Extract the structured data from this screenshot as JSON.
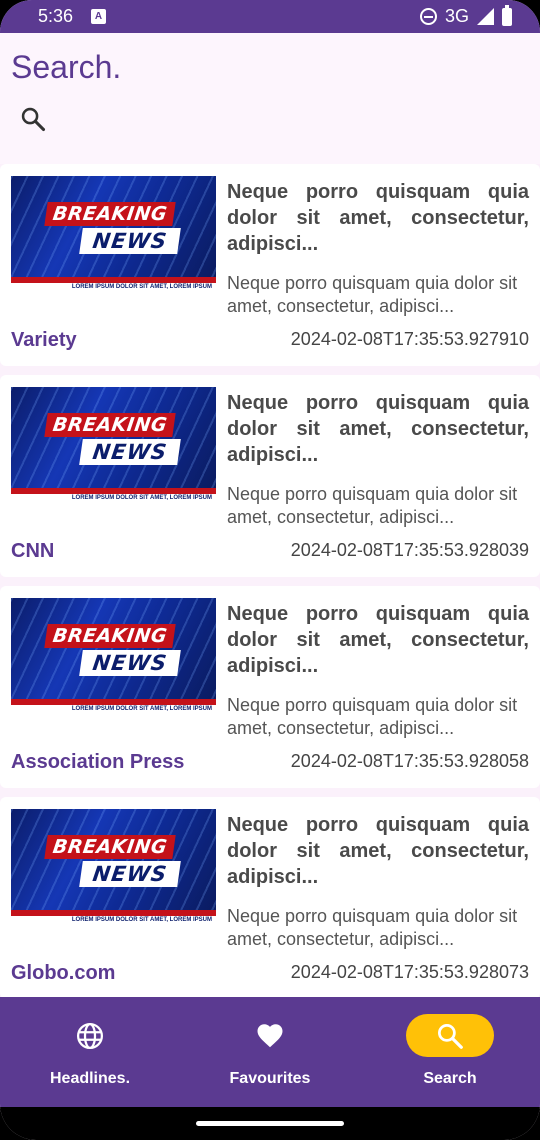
{
  "status_bar": {
    "time": "5:36",
    "network": "3G",
    "notification_icon": "a-box-icon"
  },
  "header": {
    "title": "Search.",
    "search_icon": "search-icon"
  },
  "articles": [
    {
      "thumbnail_top": "BREAKING",
      "thumbnail_bottom": "NEWS",
      "ticker": "LOREM IPSUM DOLOR SIT AMET, LOREM IPSUM",
      "headline": "Neque porro quisquam quia dolor sit amet, consectetur, adipisci...",
      "description": "Neque porro quisquam quia dolor sit amet, consectetur, adipisci...",
      "source": "Variety",
      "date": "2024-02-08T17:35:53.927910"
    },
    {
      "thumbnail_top": "BREAKING",
      "thumbnail_bottom": "NEWS",
      "ticker": "LOREM IPSUM DOLOR SIT AMET, LOREM IPSUM",
      "headline": "Neque porro quisquam quia dolor sit amet, consectetur, adipisci...",
      "description": "Neque porro quisquam quia dolor sit amet, consectetur, adipisci...",
      "source": "CNN",
      "date": "2024-02-08T17:35:53.928039"
    },
    {
      "thumbnail_top": "BREAKING",
      "thumbnail_bottom": "NEWS",
      "ticker": "LOREM IPSUM DOLOR SIT AMET, LOREM IPSUM",
      "headline": "Neque porro quisquam quia dolor sit amet, consectetur, adipisci...",
      "description": "Neque porro quisquam quia dolor sit amet, consectetur, adipisci...",
      "source": "Association Press",
      "date": "2024-02-08T17:35:53.928058"
    },
    {
      "thumbnail_top": "BREAKING",
      "thumbnail_bottom": "NEWS",
      "ticker": "LOREM IPSUM DOLOR SIT AMET, LOREM IPSUM",
      "headline": "Neque porro quisquam quia dolor sit amet, consectetur, adipisci...",
      "description": "Neque porro quisquam quia dolor sit amet, consectetur, adipisci...",
      "source": "Globo.com",
      "date": "2024-02-08T17:35:53.928073"
    }
  ],
  "bottom_nav": {
    "items": [
      {
        "label": "Headlines.",
        "icon": "globe-icon",
        "active": false
      },
      {
        "label": "Favourites",
        "icon": "heart-icon",
        "active": false
      },
      {
        "label": "Search",
        "icon": "search-icon",
        "active": true
      }
    ]
  },
  "colors": {
    "primary": "#5b3a91",
    "accent": "#ffc107",
    "background": "#fbf1fb"
  }
}
